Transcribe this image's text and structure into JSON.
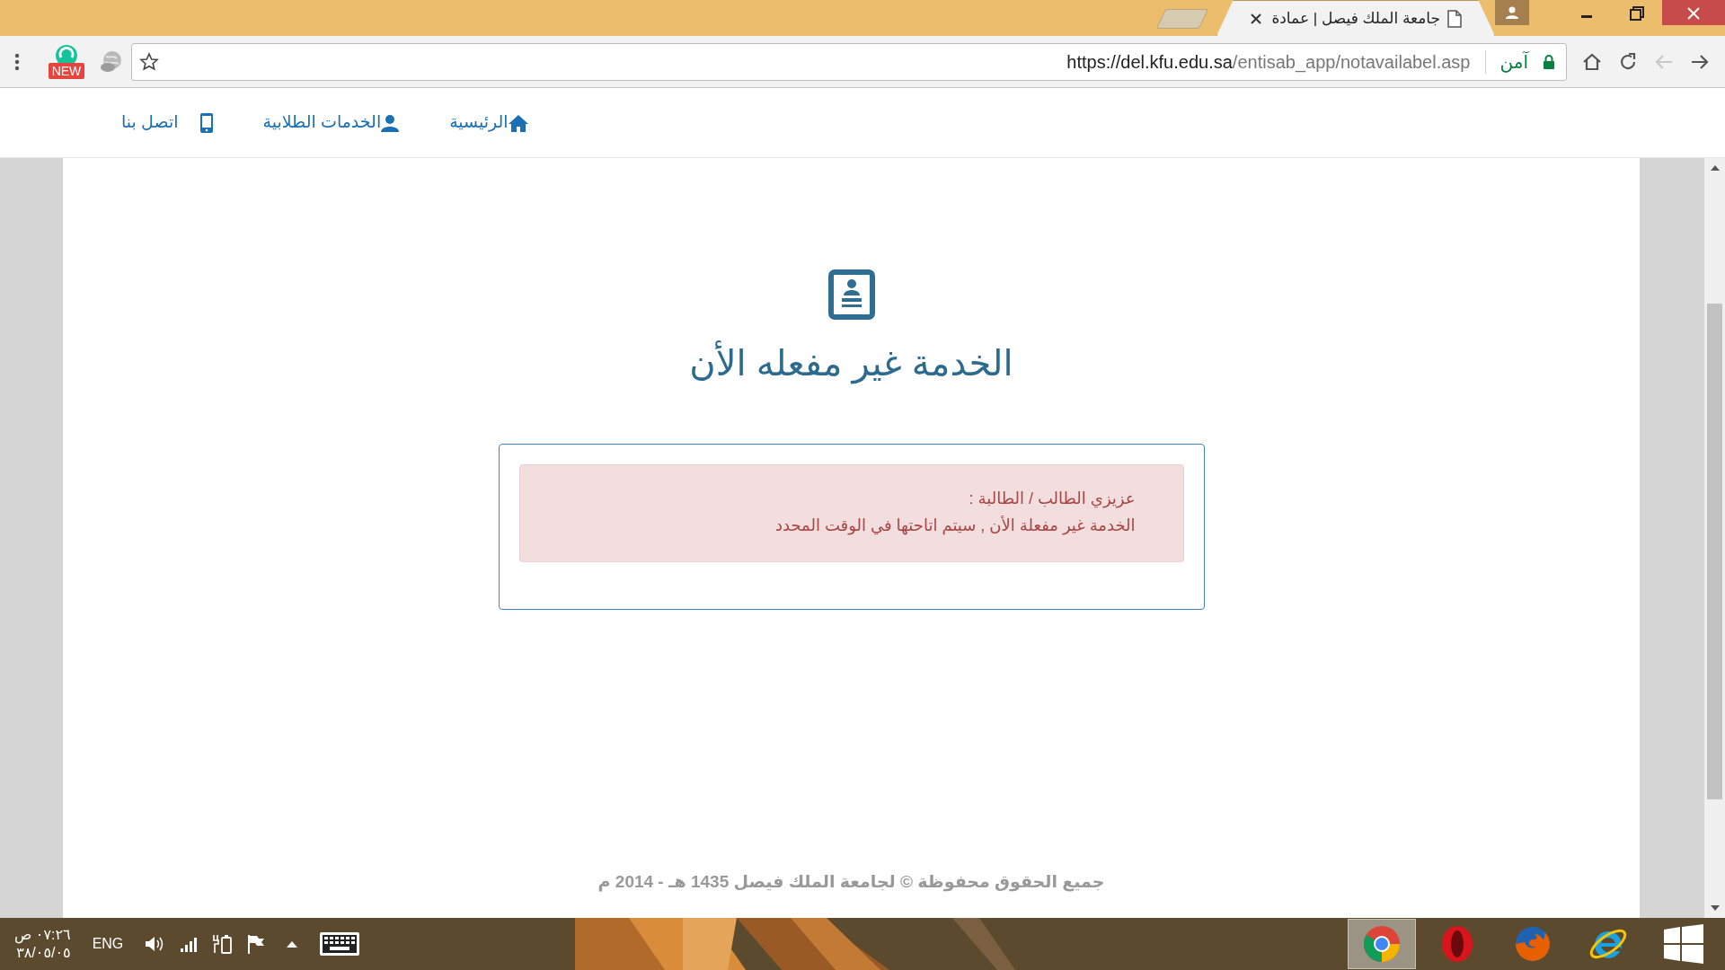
{
  "browser": {
    "tab_title": "جامعة الملك فيصل | عمادة",
    "url_host": "https://del.kfu.edu.sa",
    "url_path": "/entisab_app/notavailabel.asp",
    "security_label": "آمن",
    "extension_badge": "NEW",
    "nav_buttons": [
      {
        "kind": "forward",
        "disabled": false
      },
      {
        "kind": "back",
        "disabled": true
      },
      {
        "kind": "reload",
        "disabled": false
      },
      {
        "kind": "home",
        "disabled": false
      }
    ]
  },
  "nav": {
    "items": [
      {
        "label": "الرئيسية",
        "kind": "home"
      },
      {
        "label": "الخدمات الطلابية",
        "kind": "user"
      },
      {
        "label": "اتصل بنا",
        "kind": "mobile"
      }
    ]
  },
  "page": {
    "title": "الخدمة غير مفعله الأن",
    "alert_lines": [
      "عزيزي الطالب / الطالبة :",
      "الخدمة غير مفعلة الأن , سيتم اتاحتها في الوقت المحدد"
    ],
    "footer": "جميع الحقوق محفوظة © لجامعة الملك فيصل 1435 هـ - 2014 م"
  },
  "taskbar": {
    "time": "٠٧:٢٦ ص",
    "date": "٣٨/٠٥/٠٥",
    "language": "ENG",
    "apps": [
      {
        "kind": "chrome",
        "selected": true
      },
      {
        "kind": "opera",
        "selected": false
      },
      {
        "kind": "firefox",
        "selected": false
      },
      {
        "kind": "ie",
        "selected": false
      }
    ]
  }
}
